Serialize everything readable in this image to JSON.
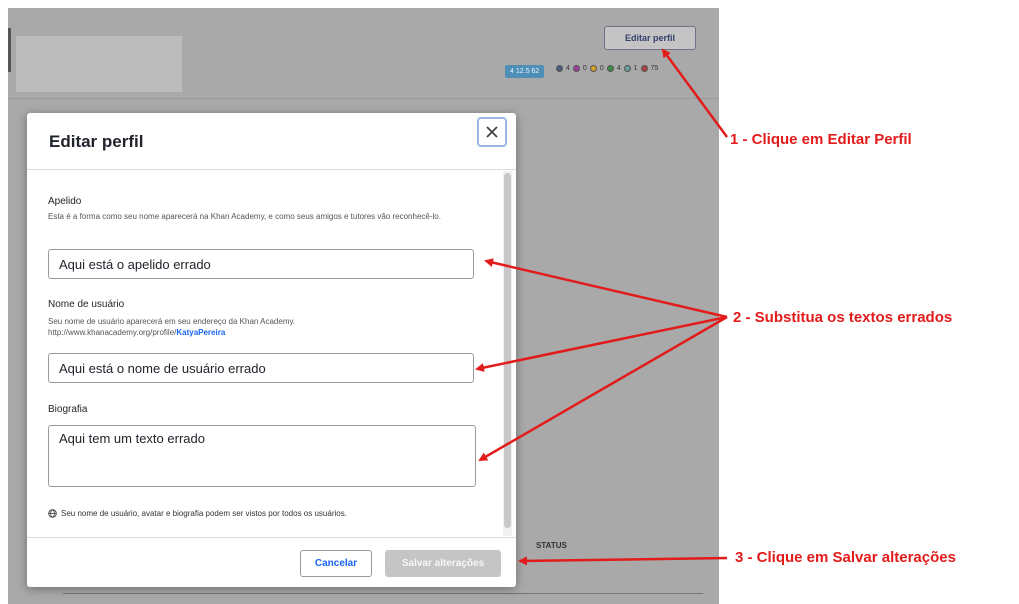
{
  "background": {
    "edit_profile_button": "Editar perfil",
    "points": "4 12.5 62",
    "badges": [
      {
        "icon": "badge-icon",
        "count": "4",
        "color": "#4a5a7a"
      },
      {
        "icon": "badge-icon",
        "count": "0",
        "color": "#9b3fa0"
      },
      {
        "icon": "badge-icon",
        "count": "0",
        "color": "#d4a22a"
      },
      {
        "icon": "badge-icon",
        "count": "4",
        "color": "#3b8a4a"
      },
      {
        "icon": "badge-icon",
        "count": "1",
        "color": "#6a9a9a"
      },
      {
        "icon": "badge-icon",
        "count": "75",
        "color": "#aa4444"
      }
    ],
    "status_header": "STATUS"
  },
  "modal": {
    "title": "Editar perfil",
    "close_icon": "close-icon",
    "nickname": {
      "label": "Apelido",
      "hint": "Esta é a forma como seu nome aparecerá na Khan Academy, e como seus amigos e tutores vão reconhecê-lo.",
      "value": "Aqui está o apelido errado"
    },
    "username": {
      "label": "Nome de usuário",
      "hint": "Seu nome de usuário aparecerá em seu endereço da Khan Academy.",
      "url_prefix": "http://www.khanacademy.org/profile/",
      "url_user": "KatyaPereira",
      "value": "Aqui está o nome de usuário errado"
    },
    "bio": {
      "label": "Biografia",
      "value": "Aqui tem um texto errado"
    },
    "privacy_note": "Seu nome de usuário, avatar e biografia podem ser vistos por todos os usuários.",
    "cancel_button": "Cancelar",
    "save_button": "Salvar alterações"
  },
  "annotations": {
    "step1": "1 - Clique em Editar Perfil",
    "step2": "2 - Substitua os textos errados",
    "step3": "3 - Clique em Salvar alterações",
    "arrow_color": "#e21b1b"
  }
}
